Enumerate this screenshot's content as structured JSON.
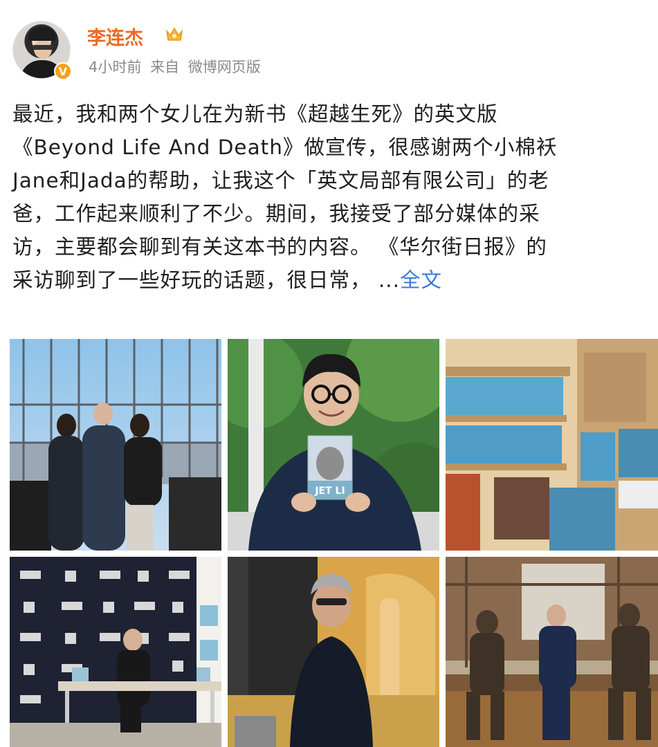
{
  "post": {
    "author": {
      "name": "李连杰",
      "verified_badge": "V",
      "avatar_icon": "avatar-portrait",
      "member_icon": "crown-icon"
    },
    "meta": {
      "time": "4小时前",
      "source_prefix": "来自",
      "source": "微博网页版"
    },
    "text_lines": [
      "最近，我和两个女儿在为新书《超越生死》的英文版",
      "《Beyond Life And Death》做宣传，很感谢两个小棉袄",
      "Jane和Jada的帮助，让我这个「英文局部有限公司」的老",
      "爸，工作起来顺利了不少。期间，我接受了部分媒体的采",
      "访，主要都会聊到有关这本书的内容。 《华尔街日报》的",
      "采访聊到了一些好玩的话题，很日常，  ..."
    ],
    "more_label": "全文",
    "book_cover_text": "JET LI",
    "colors": {
      "username": "#ea6a23",
      "link": "#3b7bd6",
      "meta": "#8a8a8a",
      "badge": "#f2a11a"
    }
  }
}
